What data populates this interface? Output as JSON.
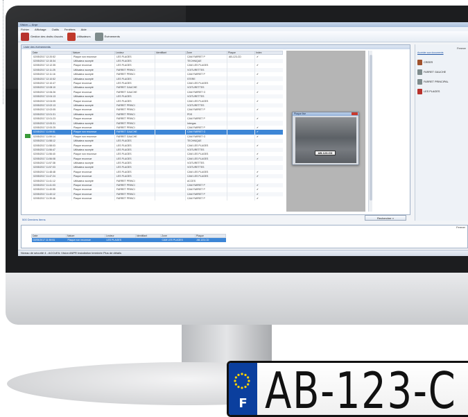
{
  "window": {
    "title": "Vision — Anpr"
  },
  "menu": [
    "Fichier",
    "Affichage",
    "Outils",
    "Fenêtres",
    "Aide"
  ],
  "toolbar": [
    {
      "label": "Gestion des droits d'accès",
      "color": "#b8322d"
    },
    {
      "label": "Utilisateurs",
      "color": "#c0392b"
    },
    {
      "label": "Événements",
      "color": "#7f8c8d"
    }
  ],
  "events_panel": {
    "title": "Liste des événements",
    "columns": [
      "Date",
      "Nature",
      "Lecteur",
      "Identifiant",
      "Zone",
      "Plaque",
      "Index"
    ],
    "rows": [
      [
        "02/05/2017 12:20:52",
        "Plaque non reconnue",
        "LES PLAGES",
        "",
        "CAM FARRET P",
        "AB-123-CD",
        "✔"
      ],
      [
        "02/05/2017 12:15:34",
        "Utilisateur accepté",
        "LES PLAGES",
        "",
        "TECHNIQUE",
        "",
        ""
      ],
      [
        "02/05/2017 12:12:35",
        "Plaque reconnue",
        "LES PLAGES",
        "",
        "CAM LES PLAGES",
        "",
        "✔"
      ],
      [
        "02/05/2017 12:11:25",
        "Utilisateur accepté",
        "FARRET PRINCI",
        "",
        "VOITURETTES",
        "",
        ""
      ],
      [
        "02/05/2017 12:11:16",
        "Utilisateur accepté",
        "FARRET PRINCI",
        "",
        "CAM FARRET P",
        "",
        "✔"
      ],
      [
        "02/05/2017 12:10:52",
        "Utilisateur accepté",
        "LES PLAGES",
        "",
        "STERE",
        "",
        ""
      ],
      [
        "02/05/2017 12:10:47",
        "Plaque reconnue",
        "LES PLAGES",
        "",
        "CAM LES PLAGES",
        "",
        "✔"
      ],
      [
        "02/05/2017 12:08:10",
        "Utilisateur accepté",
        "FARRET GAUCHE",
        "",
        "VOITURETTES",
        "",
        ""
      ],
      [
        "02/05/2017 12:06:26",
        "Plaque reconnue",
        "FARRET GAUCHE",
        "",
        "CAM FARRET G",
        "",
        "✔"
      ],
      [
        "02/05/2017 12:04:13",
        "Utilisateur accepté",
        "LES PLAGES",
        "",
        "VOITURETTES",
        "",
        ""
      ],
      [
        "02/05/2017 12:04:05",
        "Plaque reconnue",
        "LES PLAGES",
        "",
        "CAM LES PLAGES",
        "",
        "✔"
      ],
      [
        "02/05/2017 12:02:13",
        "Utilisateur accepté",
        "FARRET PRINCI",
        "",
        "VOITURETTES",
        "",
        ""
      ],
      [
        "02/05/2017 12:02:05",
        "Plaque reconnue",
        "FARRET PRINCI",
        "",
        "CAM FARRET P",
        "",
        "✔"
      ],
      [
        "02/05/2017 12:01:31",
        "Utilisateur accepté",
        "FARRET PRINCI",
        "",
        "PDS",
        "",
        ""
      ],
      [
        "02/05/2017 12:01:23",
        "Plaque reconnue",
        "FARRET PRINCI",
        "",
        "CAM FARRET P",
        "",
        "✔"
      ],
      [
        "02/05/2017 12:00:31",
        "Utilisateur accepté",
        "FARRET PRINCI",
        "",
        "Intergas",
        "",
        ""
      ],
      [
        "02/05/2017 12:00:25",
        "Plaque reconnue",
        "FARRET PRINCI",
        "",
        "CAM FARRET P",
        "",
        "✔"
      ],
      [
        "02/05/2017 11:59:51",
        "Plaque non reconnue",
        "FARRET GAUCHE",
        "",
        "CAM FARRET G",
        "",
        "✔"
      ],
      [
        "02/05/2017 11:59:14",
        "Plaque non reconnue",
        "FARRET GAUCHE",
        "",
        "CAM FARRET G",
        "",
        "✔"
      ],
      [
        "02/05/2017 11:58:12",
        "Utilisateur accepté",
        "LES PLAGES",
        "",
        "TECHNIQUE",
        "",
        ""
      ],
      [
        "02/05/2017 11:58:03",
        "Plaque reconnue",
        "LES PLAGES",
        "",
        "CAM LES PLAGES",
        "",
        "✔"
      ],
      [
        "02/05/2017 11:56:47",
        "Utilisateur accepté",
        "LES PLAGES",
        "",
        "VOITURETTES",
        "",
        ""
      ],
      [
        "02/05/2017 11:56:40",
        "Plaque non reconnue",
        "LES PLAGES",
        "",
        "CAM LES PLAGES",
        "",
        "✔"
      ],
      [
        "02/05/2017 11:56:08",
        "Plaque reconnue",
        "LES PLAGES",
        "",
        "CAM LES PLAGES",
        "",
        "✔"
      ],
      [
        "02/05/2017 11:57:38",
        "Utilisateur accepté",
        "LES PLAGES",
        "",
        "VOITURETTES",
        "",
        ""
      ],
      [
        "02/05/2017 11:57:03",
        "Utilisateur accepté",
        "LES PLAGES",
        "",
        "VOITURETTES",
        "",
        ""
      ],
      [
        "02/05/2017 11:48:48",
        "Plaque reconnue",
        "LES PLAGES",
        "",
        "CAM LES PLAGES",
        "",
        "✔"
      ],
      [
        "02/05/2017 11:47:24",
        "Plaque reconnue",
        "LES PLAGES",
        "",
        "CAM LES PLAGES",
        "",
        "✔"
      ],
      [
        "02/05/2017 11:41:12",
        "Utilisateur accepté",
        "FARRET PRINCI",
        "",
        "ACCES",
        "",
        ""
      ],
      [
        "02/05/2017 11:41:03",
        "Plaque reconnue",
        "FARRET PRINCI",
        "",
        "CAM FARRET P",
        "",
        "✔"
      ],
      [
        "02/05/2017 11:40:55",
        "Plaque reconnue",
        "FARRET PRINCI",
        "",
        "CAM FARRET P",
        "",
        "✔"
      ],
      [
        "02/05/2017 11:40:12",
        "Plaque reconnue",
        "FARRET PRINCI",
        "",
        "CAM FARRET P",
        "",
        "✔"
      ],
      [
        "02/05/2017 11:39:46",
        "Plaque reconnue",
        "FARRET PRINCI",
        "",
        "CAM FARRET P",
        "",
        "✔"
      ]
    ],
    "selected_row": 17,
    "footer_link": "500 Derniers items",
    "find_button": "Rechercher »"
  },
  "image_popup": {
    "title": "Plaque live",
    "plate_text": "AB-123-CD"
  },
  "side_panel": {
    "close": "Fermer",
    "link": "Accéder aux documents",
    "items": [
      {
        "label": "CREER",
        "color": "#a0522d"
      },
      {
        "label": "FARRET GAUCHE",
        "color": "#7f8c8d"
      },
      {
        "label": "FARRET PRINCIPAL",
        "color": "#7f8c8d"
      },
      {
        "label": "LES PLAGES",
        "color": "#b8322d"
      }
    ]
  },
  "bottom_panel": {
    "close": "Fermer",
    "columns": [
      "Date",
      "Nature",
      "Lecteur",
      "Identifiant",
      "Zone",
      "Plaque"
    ],
    "row": [
      "02/05/2017 11:59:51",
      "Plaque non reconnue",
      "LES PLAGES",
      "",
      "CAM LES PLAGES",
      "AB-123-CD"
    ]
  },
  "status_bar": "Niveau de sécurité 4 - ACCUEIL   Vision ANPR   Installation terminée   Plus de détails",
  "license_plate": {
    "country": "F",
    "number": "AB-123-C",
    "eu_color": "#0b3f9e"
  }
}
